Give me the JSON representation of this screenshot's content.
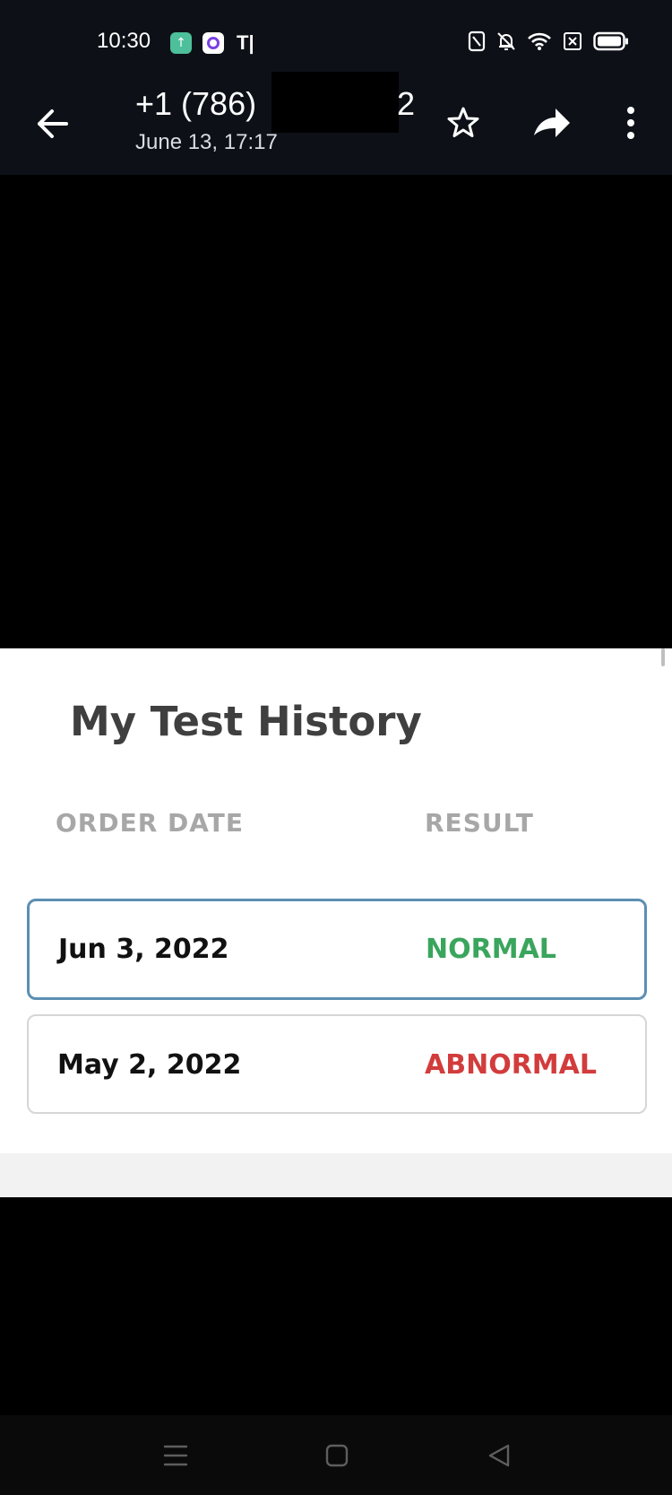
{
  "status_bar": {
    "time": "10:30",
    "app_letter": "T|"
  },
  "header": {
    "contact_number": "+1 (786)",
    "contact_number_suffix": "2",
    "date": "June 13, 17:17"
  },
  "card": {
    "title": "My Test History",
    "columns": {
      "date": "ORDER DATE",
      "result": "RESULT"
    },
    "rows": [
      {
        "date": "Jun 3, 2022",
        "result": "NORMAL",
        "result_color": "#3aa55d"
      },
      {
        "date": "May 2, 2022",
        "result": "ABNORMAL",
        "result_color": "#d23c3c"
      }
    ]
  },
  "colors": {
    "app_bar": "#0d1117",
    "selected_border": "#5c8fb3",
    "normal": "#3aa55d",
    "abnormal": "#d23c3c"
  },
  "icons": [
    "back-arrow-icon",
    "star-icon",
    "share-icon",
    "more-vert-icon",
    "nfc-icon",
    "mute-icon",
    "wifi-icon",
    "sim-icon",
    "battery-icon",
    "menu-icon",
    "home-icon",
    "back-triangle-icon"
  ]
}
